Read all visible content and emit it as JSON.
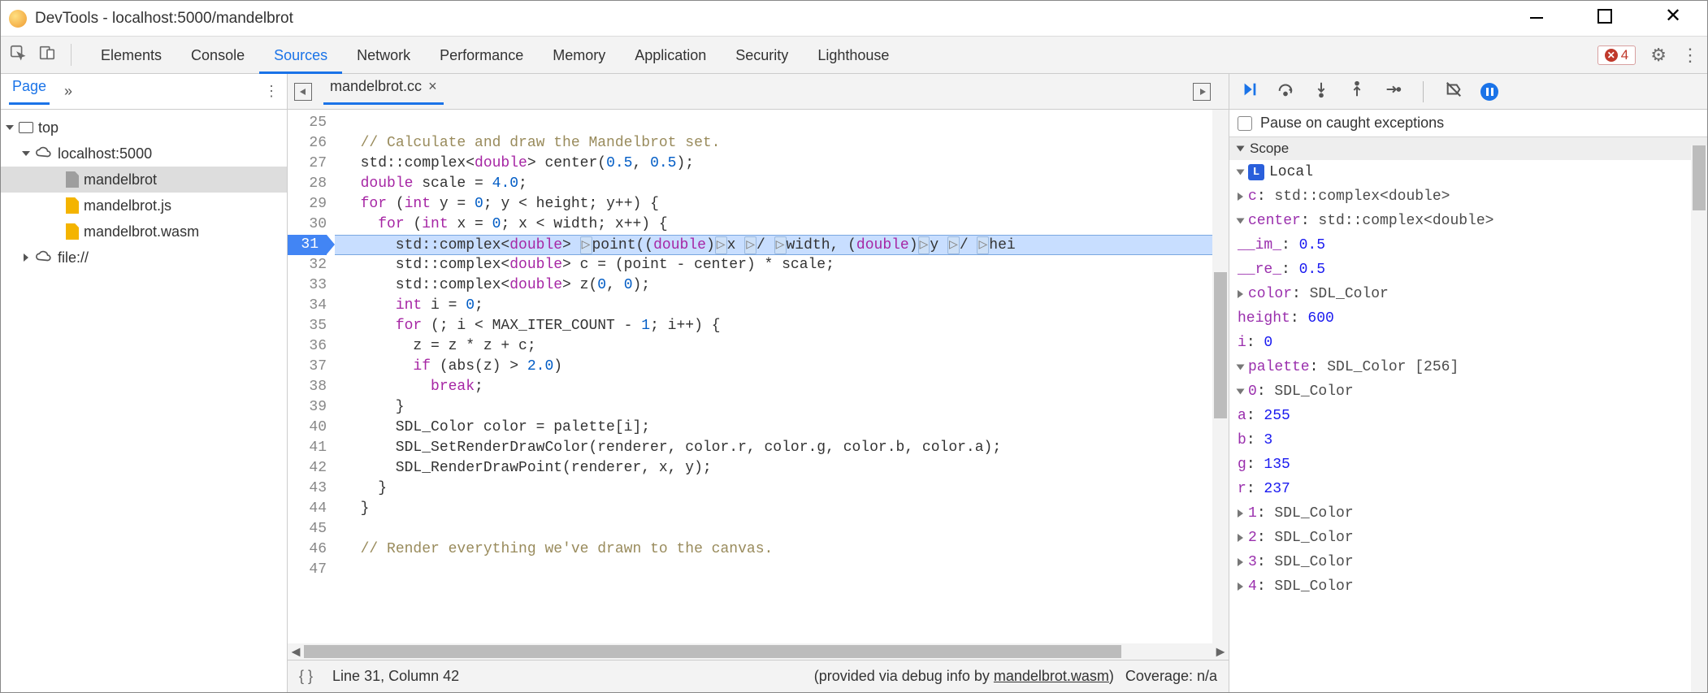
{
  "window": {
    "title": "DevTools - localhost:5000/mandelbrot"
  },
  "tabs": {
    "items": [
      "Elements",
      "Console",
      "Sources",
      "Network",
      "Performance",
      "Memory",
      "Application",
      "Security",
      "Lighthouse"
    ],
    "active": "Sources",
    "errors": "4"
  },
  "sidebar": {
    "pagetab": "Page",
    "tree": {
      "top": "top",
      "host": "localhost:5000",
      "files": [
        "mandelbrot",
        "mandelbrot.js",
        "mandelbrot.wasm"
      ],
      "file_scheme": "file://"
    }
  },
  "editor": {
    "open_tab": "mandelbrot.cc",
    "first_line_no": 25,
    "breakpoint_line": 31,
    "lines": [
      "",
      "  // Calculate and draw the Mandelbrot set.",
      "  std::complex<double> center(0.5, 0.5);",
      "  double scale = 4.0;",
      "  for (int y = 0; y < height; y++) {",
      "    for (int x = 0; x < width; x++) {",
      "      std::complex<double> ▷point((double)▷x ▷/ ▷width, (double)▷y ▷/ ▷hei",
      "      std::complex<double> c = (point - center) * scale;",
      "      std::complex<double> z(0, 0);",
      "      int i = 0;",
      "      for (; i < MAX_ITER_COUNT - 1; i++) {",
      "        z = z * z + c;",
      "        if (abs(z) > 2.0)",
      "          break;",
      "      }",
      "      SDL_Color color = palette[i];",
      "      SDL_SetRenderDrawColor(renderer, color.r, color.g, color.b, color.a);",
      "      SDL_RenderDrawPoint(renderer, x, y);",
      "    }",
      "  }",
      "",
      "  // Render everything we've drawn to the canvas.",
      ""
    ]
  },
  "status": {
    "cursor": "Line 31, Column 42",
    "provided_prefix": "(provided via debug info by ",
    "provided_link": "mandelbrot.wasm",
    "provided_suffix": ")",
    "coverage": "Coverage: n/a"
  },
  "debugger": {
    "pause_on_caught": "Pause on caught exceptions",
    "scope_header": "Scope",
    "local_label": "Local",
    "vars": {
      "c": {
        "name": "c",
        "type": "std::complex<double>"
      },
      "center": {
        "name": "center",
        "type": "std::complex<double>",
        "im_key": "__im_",
        "im_val": "0.5",
        "re_key": "__re_",
        "re_val": "0.5"
      },
      "color": {
        "name": "color",
        "type": "SDL_Color"
      },
      "height": {
        "name": "height",
        "val": "600"
      },
      "i": {
        "name": "i",
        "val": "0"
      },
      "palette": {
        "name": "palette",
        "type": "SDL_Color [256]",
        "items": [
          {
            "idx": "0",
            "type": "SDL_Color",
            "a": "255",
            "b": "3",
            "g": "135",
            "r": "237"
          },
          {
            "idx": "1",
            "type": "SDL_Color"
          },
          {
            "idx": "2",
            "type": "SDL_Color"
          },
          {
            "idx": "3",
            "type": "SDL_Color"
          },
          {
            "idx": "4",
            "type": "SDL_Color"
          }
        ]
      }
    }
  }
}
